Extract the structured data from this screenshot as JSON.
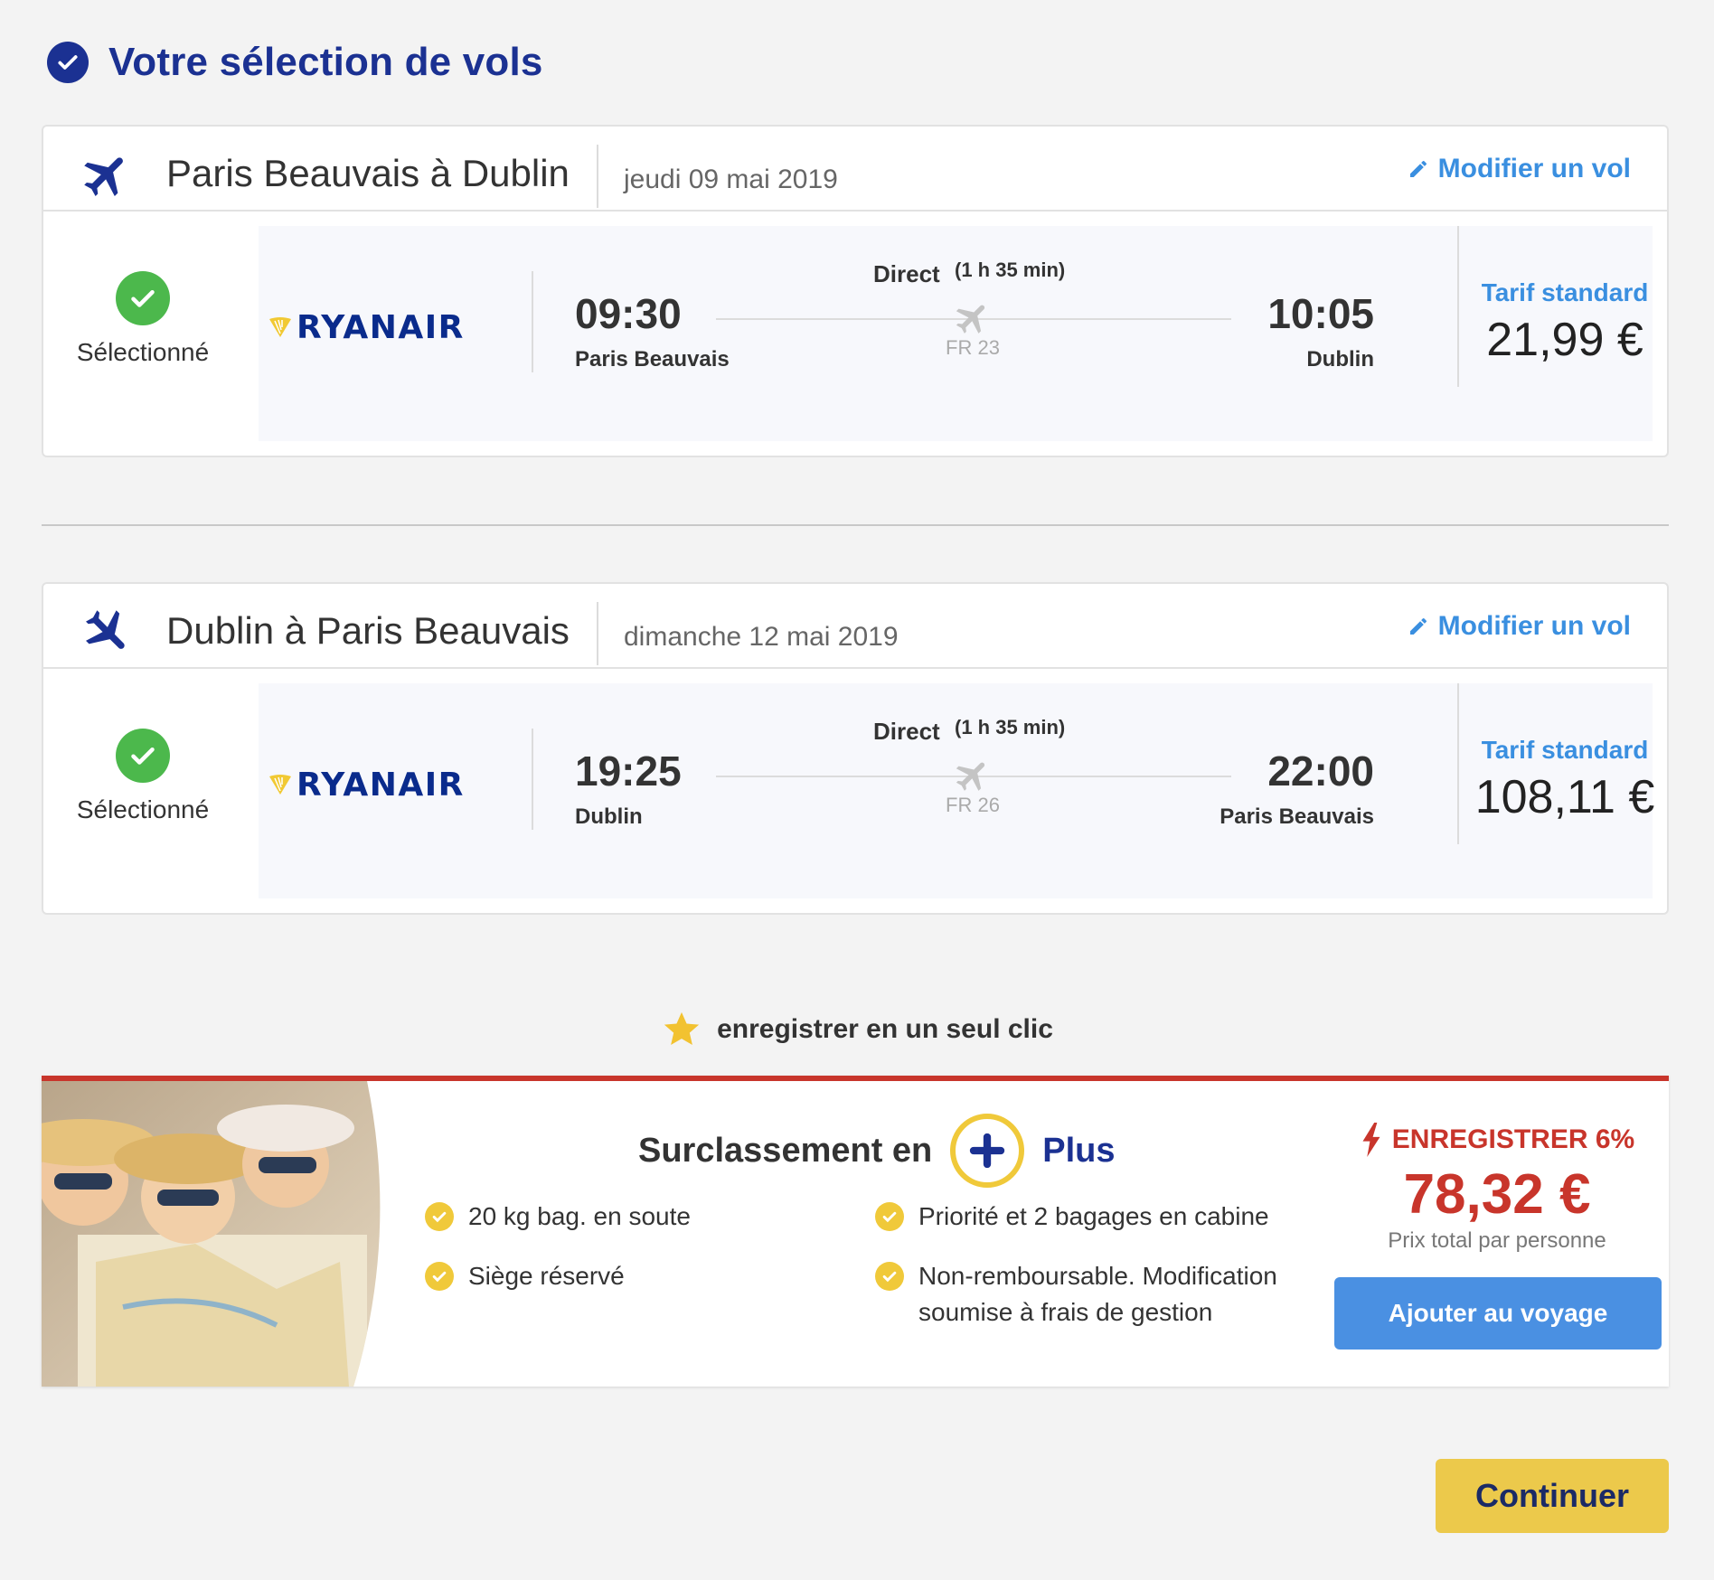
{
  "page_title": "Votre sélection de vols",
  "flights": [
    {
      "route": "Paris Beauvais à Dublin",
      "date": "jeudi 09 mai 2019",
      "edit_label": "Modifier un vol",
      "selected_label": "Sélectionné",
      "airline": "RYANAIR",
      "departure_time": "09:30",
      "departure_city": "Paris Beauvais",
      "arrival_time": "10:05",
      "arrival_city": "Dublin",
      "stop_type": "Direct",
      "duration": "(1 h 35 min)",
      "flight_number": "FR 23",
      "fare_label": "Tarif standard",
      "price": "21,99 €"
    },
    {
      "route": "Dublin à Paris Beauvais",
      "date": "dimanche 12 mai 2019",
      "edit_label": "Modifier un vol",
      "selected_label": "Sélectionné",
      "airline": "RYANAIR",
      "departure_time": "19:25",
      "departure_city": "Dublin",
      "arrival_time": "22:00",
      "arrival_city": "Paris Beauvais",
      "stop_type": "Direct",
      "duration": "(1 h 35 min)",
      "flight_number": "FR 26",
      "fare_label": "Tarif standard",
      "price": "108,11 €"
    }
  ],
  "save_banner": "enregistrer en un seul clic",
  "upsell": {
    "title": "Surclassement en",
    "brand": "Plus",
    "features": [
      "20 kg bag. en soute",
      "Siège réservé",
      "Priorité et 2 bagages en cabine",
      "Non-remboursable. Modification soumise à frais de gestion"
    ],
    "save_label": "ENREGISTRER 6%",
    "price": "78,32 €",
    "price_note": "Prix total par personne",
    "button_label": "Ajouter au voyage"
  },
  "continue_label": "Continuer",
  "colors": {
    "brand_blue": "#1b3192",
    "link_blue": "#3a8fe0",
    "accent_red": "#c8352b",
    "accent_yellow": "#ecc94b",
    "success_green": "#4cb84c"
  },
  "icons": [
    "check-circle-icon",
    "plane-icon",
    "pencil-icon",
    "star-icon",
    "bolt-icon",
    "plus-icon"
  ]
}
